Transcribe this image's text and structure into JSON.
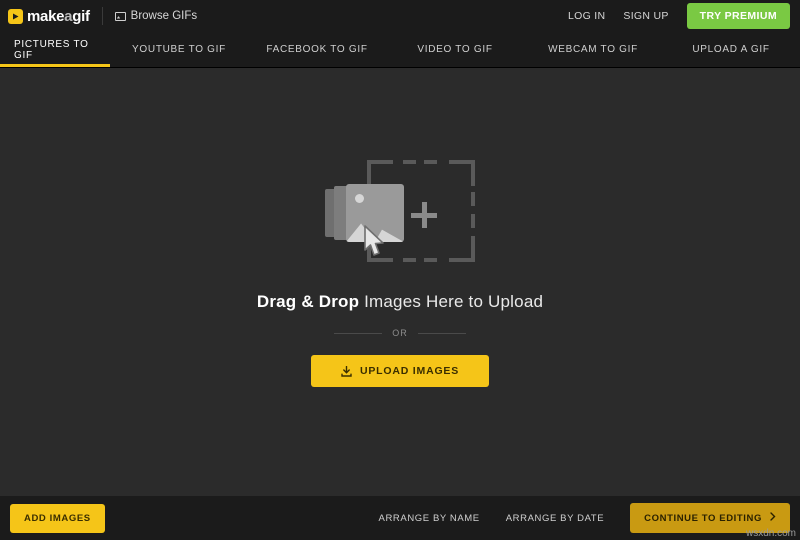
{
  "header": {
    "logo_text_main": "make",
    "logo_text_a": "a",
    "logo_text_gif": "gif",
    "logo_icon": "play-arrow-icon",
    "browse_label": "Browse GIFs",
    "browse_icon": "image-icon",
    "login_label": "LOG IN",
    "signup_label": "SIGN UP",
    "premium_label": "TRY PREMIUM",
    "premium_color": "#7ac943"
  },
  "nav": {
    "items": [
      {
        "label": "PICTURES TO GIF",
        "active": true
      },
      {
        "label": "YOUTUBE TO GIF",
        "active": false
      },
      {
        "label": "FACEBOOK TO GIF",
        "active": false
      },
      {
        "label": "VIDEO TO GIF",
        "active": false
      },
      {
        "label": "WEBCAM TO GIF",
        "active": false
      },
      {
        "label": "UPLOAD A GIF",
        "active": false
      }
    ],
    "active_underline_color": "#f5c518"
  },
  "dropzone": {
    "graphic_icon": "image-upload-placeholder-icon",
    "headline_bold": "Drag & Drop",
    "headline_rest": " Images Here to Upload",
    "or_label": "OR",
    "upload_button_label": "UPLOAD IMAGES",
    "upload_button_icon": "upload-icon",
    "upload_button_color": "#f5c518"
  },
  "footer": {
    "add_images_label": "ADD IMAGES",
    "arrange_by_name_label": "ARRANGE BY NAME",
    "arrange_by_date_label": "ARRANGE BY DATE",
    "continue_label": "CONTINUE TO EDITING",
    "continue_icon": "chevron-right-icon"
  },
  "watermark": {
    "text": "wsxdn.com"
  }
}
